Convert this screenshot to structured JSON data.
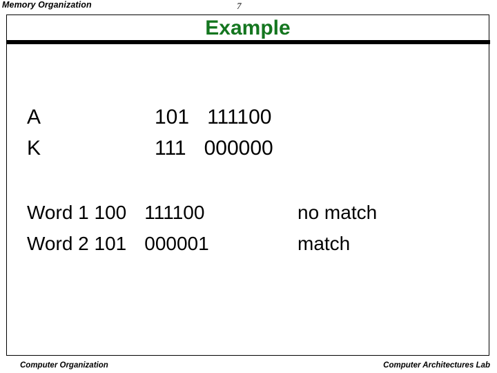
{
  "header": {
    "section_title": "Memory Organization",
    "page_number": "7"
  },
  "slide": {
    "title": "Example",
    "title_color": "#14761f",
    "rule_color": "#000000",
    "frame_border_color": "#000000"
  },
  "registers": [
    {
      "label": "A",
      "tag_bits": "101",
      "data_bits": "111100"
    },
    {
      "label": "K",
      "tag_bits": "111",
      "data_bits": "000000"
    }
  ],
  "words": [
    {
      "label": "Word 1",
      "tag_bits": "100",
      "data_bits": "111100",
      "result": "no match"
    },
    {
      "label": "Word 2",
      "tag_bits": "101",
      "data_bits": "000001",
      "result": "match"
    }
  ],
  "footer": {
    "left": "Computer Organization",
    "right": "Computer Architectures Lab"
  }
}
